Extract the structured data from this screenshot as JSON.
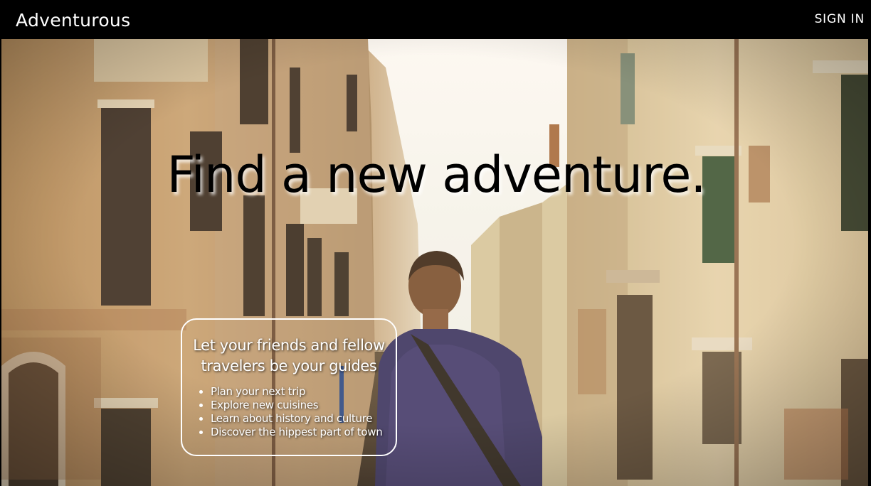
{
  "navbar": {
    "brand": "Adventurous",
    "signin_label": "SIGN IN"
  },
  "hero": {
    "headline": "Find a new adventure.",
    "info_box": {
      "heading": "Let your friends and fellow travelers be your guides",
      "items": [
        "Plan your next trip",
        "Explore new cuisines",
        "Learn about history and culture",
        "Discover the hippest part of town"
      ]
    }
  },
  "colors": {
    "navbar_bg": "#000000",
    "navbar_text": "#ffffff",
    "headline": "#000000",
    "info_text": "#ffffff",
    "info_border": "#ffffff"
  }
}
